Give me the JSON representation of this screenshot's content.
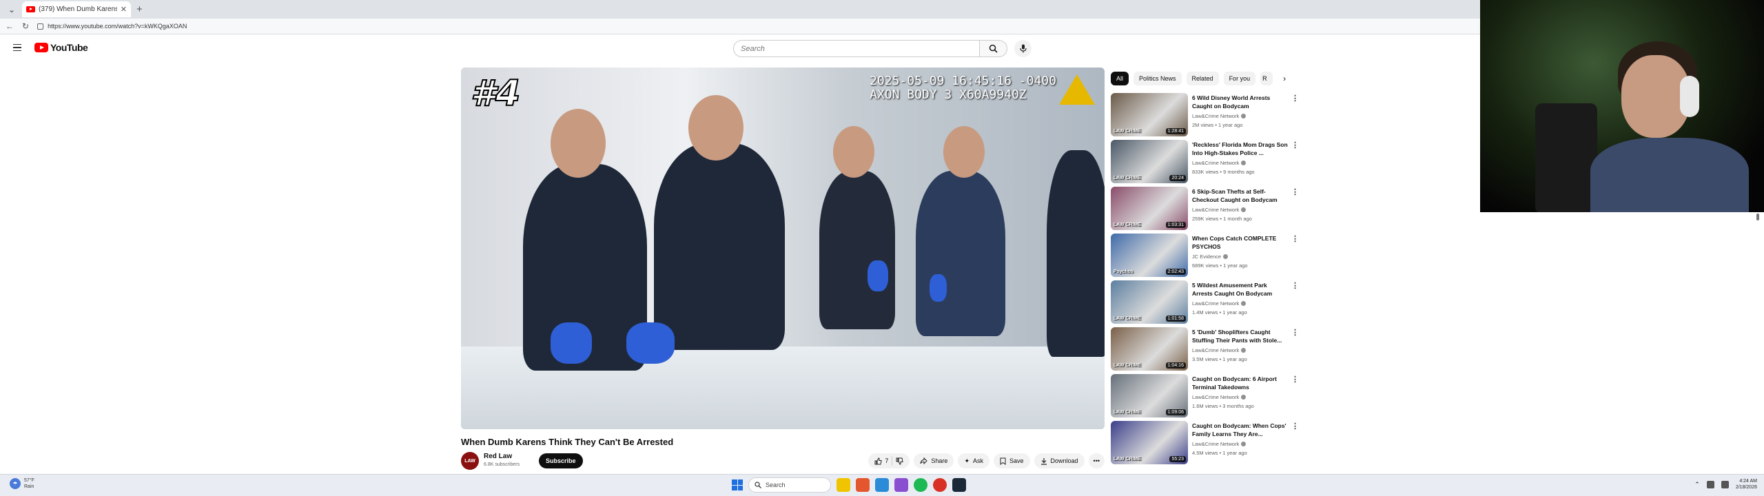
{
  "browser": {
    "tab_title": "(379) When Dumb Karens Thi...",
    "url": "https://www.youtube.com/watch?v=kWKQgaXOAN"
  },
  "youtube": {
    "logo_text": "YouTube",
    "search_placeholder": "Search"
  },
  "player": {
    "rank_overlay": "#4",
    "bodycam_line1": "2025-05-09 16:45:16 -0400",
    "bodycam_line2": "AXON BODY 3 X60A9940Z"
  },
  "video": {
    "title": "When Dumb Karens Think They Can't Be Arrested",
    "channel_name": "Red Law",
    "channel_avatar_text": "LAW",
    "channel_subscribers": "6.8K subscribers",
    "subscribe_label": "Subscribe",
    "like_count": "7",
    "share_label": "Share",
    "ask_label": "Ask",
    "save_label": "Save",
    "download_label": "Download"
  },
  "sidebar": {
    "chips": [
      "All",
      "Politics News",
      "Related",
      "For you",
      "R"
    ],
    "recommendations": [
      {
        "title": "6 Wild Disney World Arrests Caught on Bodycam",
        "channel": "Law&Crime Network",
        "meta": "2M views • 1 year ago",
        "duration": "1:28:41",
        "thumb_tag": "LAW CRIME",
        "thumb_color": "#6b5a48"
      },
      {
        "title": "'Reckless' Florida Mom Drags Son Into High-Stakes Police ...",
        "channel": "Law&Crime Network",
        "meta": "833K views • 9 months ago",
        "duration": "20:24",
        "thumb_tag": "LAW CRIME",
        "thumb_color": "#4a5866"
      },
      {
        "title": "6 Skip-Scan Thefts at Self-Checkout Caught on Bodycam",
        "channel": "Law&Crime Network",
        "meta": "259K views • 1 month ago",
        "duration": "1:03:31",
        "thumb_tag": "LAW CRIME",
        "thumb_color": "#8a4c6a"
      },
      {
        "title": "When Cops Catch COMPLETE PSYCHOS",
        "channel": "JC Evidence",
        "meta": "689K views • 1 year ago",
        "duration": "2:02:43",
        "thumb_tag": "Psychos",
        "thumb_color": "#3e6aa8"
      },
      {
        "title": "5 Wildest Amusement Park Arrests Caught On Bodycam",
        "channel": "Law&Crime Network",
        "meta": "1.4M views • 1 year ago",
        "duration": "1:01:58",
        "thumb_tag": "LAW CRIME",
        "thumb_color": "#5c7fa0"
      },
      {
        "title": "5 'Dumb' Shoplifters Caught Stuffing Their Pants with Stole...",
        "channel": "Law&Crime Network",
        "meta": "3.5M views • 1 year ago",
        "duration": "1:04:16",
        "thumb_tag": "LAW CRIME",
        "thumb_color": "#7a6048"
      },
      {
        "title": "Caught on Bodycam: 6 Airport Terminal Takedowns",
        "channel": "Law&Crime Network",
        "meta": "1.6M views • 3 months ago",
        "duration": "1:09:06",
        "thumb_tag": "LAW CRIME",
        "thumb_color": "#66707a"
      },
      {
        "title": "Caught on Bodycam: When Cops' Family Learns They Are...",
        "channel": "Law&Crime Network",
        "meta": "4.5M views • 1 year ago",
        "duration": "55:23",
        "thumb_tag": "LAW CRIME",
        "thumb_color": "#3b3f8a"
      }
    ]
  },
  "taskbar": {
    "weather_temp": "57°F",
    "weather_desc": "Rain",
    "search_label": "Search",
    "time": "4:24 AM",
    "date": "2/18/2026"
  }
}
